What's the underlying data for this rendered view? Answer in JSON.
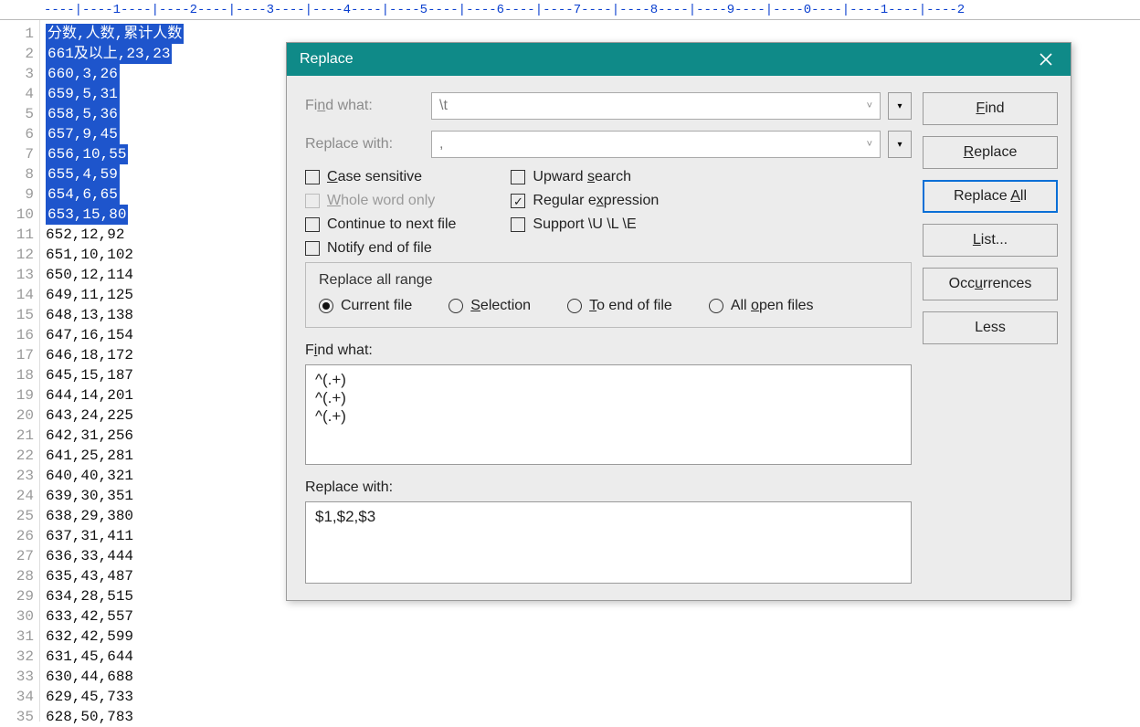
{
  "ruler": "----|----1----|----2----|----3----|----4----|----5----|----6----|----7----|----8----|----9----|----0----|----1----|----2",
  "lines": [
    {
      "n": 1,
      "sel": true,
      "text": "分数,人数,累计人数"
    },
    {
      "n": 2,
      "sel": true,
      "text": "661及以上,23,23"
    },
    {
      "n": 3,
      "sel": true,
      "text": "660,3,26"
    },
    {
      "n": 4,
      "sel": true,
      "text": "659,5,31"
    },
    {
      "n": 5,
      "sel": true,
      "text": "658,5,36"
    },
    {
      "n": 6,
      "sel": true,
      "text": "657,9,45"
    },
    {
      "n": 7,
      "sel": true,
      "text": "656,10,55"
    },
    {
      "n": 8,
      "sel": true,
      "text": "655,4,59"
    },
    {
      "n": 9,
      "sel": true,
      "text": "654,6,65"
    },
    {
      "n": 10,
      "sel": true,
      "text": "653,15,80"
    },
    {
      "n": 11,
      "sel": false,
      "text": "652,12,92"
    },
    {
      "n": 12,
      "sel": false,
      "text": "651,10,102"
    },
    {
      "n": 13,
      "sel": false,
      "text": "650,12,114"
    },
    {
      "n": 14,
      "sel": false,
      "text": "649,11,125"
    },
    {
      "n": 15,
      "sel": false,
      "text": "648,13,138"
    },
    {
      "n": 16,
      "sel": false,
      "text": "647,16,154"
    },
    {
      "n": 17,
      "sel": false,
      "text": "646,18,172"
    },
    {
      "n": 18,
      "sel": false,
      "text": "645,15,187"
    },
    {
      "n": 19,
      "sel": false,
      "text": "644,14,201"
    },
    {
      "n": 20,
      "sel": false,
      "text": "643,24,225"
    },
    {
      "n": 21,
      "sel": false,
      "text": "642,31,256"
    },
    {
      "n": 22,
      "sel": false,
      "text": "641,25,281"
    },
    {
      "n": 23,
      "sel": false,
      "text": "640,40,321"
    },
    {
      "n": 24,
      "sel": false,
      "text": "639,30,351"
    },
    {
      "n": 25,
      "sel": false,
      "text": "638,29,380"
    },
    {
      "n": 26,
      "sel": false,
      "text": "637,31,411"
    },
    {
      "n": 27,
      "sel": false,
      "text": "636,33,444"
    },
    {
      "n": 28,
      "sel": false,
      "text": "635,43,487"
    },
    {
      "n": 29,
      "sel": false,
      "text": "634,28,515"
    },
    {
      "n": 30,
      "sel": false,
      "text": "633,42,557"
    },
    {
      "n": 31,
      "sel": false,
      "text": "632,42,599"
    },
    {
      "n": 32,
      "sel": false,
      "text": "631,45,644"
    },
    {
      "n": 33,
      "sel": false,
      "text": "630,44,688"
    },
    {
      "n": 34,
      "sel": false,
      "text": "629,45,733"
    },
    {
      "n": 35,
      "sel": false,
      "text": "628,50,783"
    }
  ],
  "dialog": {
    "title": "Replace",
    "find_label_pre": "Fi",
    "find_label_u": "n",
    "find_label_post": "d what:",
    "find_value": "\\t",
    "replace_label": "Replace with:",
    "replace_value": ",",
    "checks": {
      "case_pre": "",
      "case_u": "C",
      "case_post": "ase sensitive",
      "case_on": false,
      "whole_pre": "",
      "whole_u": "W",
      "whole_post": "hole word only",
      "whole_on": false,
      "cont_text": "Continue to next file",
      "cont_on": false,
      "notify_text": "Notify end of file",
      "notify_on": false,
      "upward_pre": "Upward ",
      "upward_u": "s",
      "upward_post": "earch",
      "upward_on": false,
      "regex_pre": "Regular e",
      "regex_u": "x",
      "regex_post": "pression",
      "regex_on": true,
      "support_text": "Support \\U \\L \\E",
      "support_on": false
    },
    "group_title": "Replace all range",
    "radios": {
      "current": "Current file",
      "selection_u": "S",
      "selection_post": "election",
      "toend_u": "T",
      "toend_post": "o end of file",
      "allopen_pre": "All ",
      "allopen_u": "o",
      "allopen_post": "pen files",
      "selected": "current"
    },
    "multi_find_label_pre": "F",
    "multi_find_label_u": "i",
    "multi_find_label_post": "nd what:",
    "multi_find_value": "^(.+)\n^(.+)\n^(.+)",
    "multi_replace_label": "Replace with:",
    "multi_replace_value": "$1,$2,$3",
    "buttons": {
      "find_u": "F",
      "find_post": "ind",
      "replace_u": "R",
      "replace_post": "eplace",
      "replaceall_pre": "Replace ",
      "replaceall_u": "A",
      "replaceall_post": "ll",
      "list_u": "L",
      "list_post": "ist...",
      "occ_pre": "Occ",
      "occ_u": "u",
      "occ_post": "rrences",
      "less": "Less"
    }
  }
}
